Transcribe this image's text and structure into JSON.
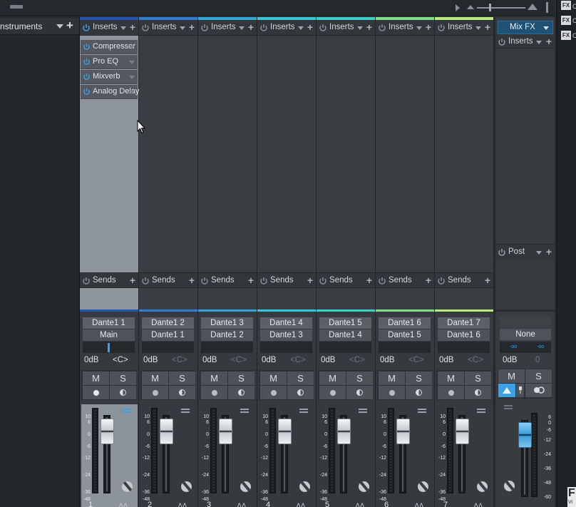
{
  "left_panel": {
    "header_label": "nstruments",
    "add_label": "+"
  },
  "colors": {
    "accent": "#3aa3e8",
    "selected_strip": "#8f959d",
    "strip_colors": [
      "#2456b8",
      "#2f7fd6",
      "#2fa7d8",
      "#35c8d8",
      "#3ad1cb",
      "#7fe08a",
      "#b7ec7c"
    ]
  },
  "strip_common": {
    "inserts_label": "Inserts",
    "sends_label": "Sends",
    "mute_label": "M",
    "solo_label": "S",
    "add_label": "+"
  },
  "channels": [
    {
      "number": "1",
      "input": "Dante1 1",
      "output": "Main",
      "volume": "0dB",
      "pan": "<C>",
      "inserts": [
        "Compressor",
        "Pro EQ",
        "Mixverb",
        "Analog Delay"
      ],
      "selected": true
    },
    {
      "number": "2",
      "input": "Dante1 2",
      "output": "Dante1 1",
      "volume": "0dB",
      "pan": "<C>",
      "inserts": []
    },
    {
      "number": "3",
      "input": "Dante1 3",
      "output": "Dante1 2",
      "volume": "0dB",
      "pan": "<C>",
      "inserts": []
    },
    {
      "number": "4",
      "input": "Dante1 4",
      "output": "Dante1 3",
      "volume": "0dB",
      "pan": "<C>",
      "inserts": []
    },
    {
      "number": "5",
      "input": "Dante1 5",
      "output": "Dante1 4",
      "volume": "0dB",
      "pan": "<C>",
      "inserts": []
    },
    {
      "number": "6",
      "input": "Dante1 6",
      "output": "Dante1 5",
      "volume": "0dB",
      "pan": "<C>",
      "inserts": []
    },
    {
      "number": "7",
      "input": "Dante1 7",
      "output": "Dante1 6",
      "volume": "0dB",
      "pan": "<C>",
      "inserts": []
    }
  ],
  "meter_scale": [
    "10",
    "6",
    "0",
    "-6",
    "-12",
    "-24",
    "-36",
    "-48"
  ],
  "fx_channel": {
    "mix_fx_label": "Mix FX",
    "inserts_label": "Inserts",
    "post_label": "Post",
    "output": "None",
    "send_left": "-oo",
    "send_right": "-oo",
    "volume": "0dB",
    "pan": "0",
    "mute_label": "M",
    "solo_label": "S",
    "scale": [
      "6",
      "0",
      "-6",
      "-12",
      "-24",
      "-36",
      "-48",
      "-60"
    ]
  },
  "browser_strip": {
    "items": [
      {
        "badge": "FX",
        "text": "C"
      },
      {
        "badge": "FX",
        "text": "C"
      },
      {
        "badge": "FX",
        "text": "C"
      }
    ],
    "footer_badge": "F",
    "footer_sub": "Vi"
  }
}
